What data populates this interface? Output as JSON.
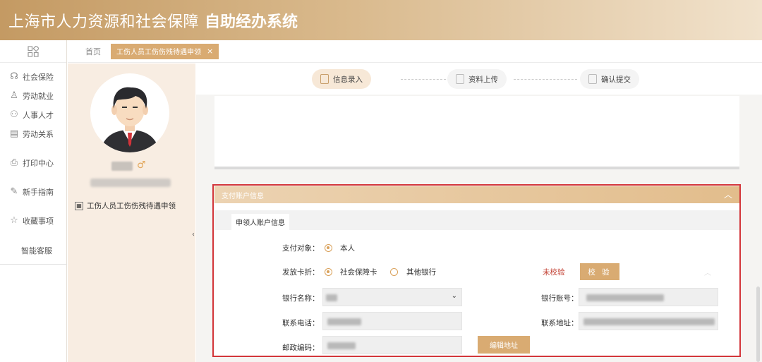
{
  "header": {
    "title": "上海市人力资源和社会保障",
    "subtitle": "自助经办系统"
  },
  "nav": {
    "apps_icon": "grid-icon",
    "items": [
      {
        "label": "社会保险",
        "icon": "headset-icon"
      },
      {
        "label": "劳动就业",
        "icon": "person-icon"
      },
      {
        "label": "人事人才",
        "icon": "people-icon"
      },
      {
        "label": "劳动关系",
        "icon": "document-icon"
      },
      {
        "label": "打印中心",
        "icon": "printer-icon"
      },
      {
        "label": "新手指南",
        "icon": "edit-icon"
      },
      {
        "label": "收藏事项",
        "icon": "star-icon"
      },
      {
        "label": "智能客服"
      }
    ]
  },
  "tabs": {
    "home": "首页",
    "active": "工伤人员工伤伤残待遇申领",
    "close": "×"
  },
  "profile": {
    "gender_symbol": "♂",
    "service_link": "工伤人员工伤伤残待遇申领"
  },
  "steps": [
    {
      "label": "信息录入",
      "state": "active"
    },
    {
      "label": "资料上传",
      "state": "pending"
    },
    {
      "label": "确认提交",
      "state": "pending"
    }
  ],
  "payment": {
    "section_title": "支付账户信息",
    "collapse_icon": "chevron-up-icon",
    "subtab": "申领人账户信息",
    "payee_label": "支付对象：",
    "payee_value": "本人",
    "card_label": "发放卡折：",
    "card_options": [
      "社会保障卡",
      "其他银行"
    ],
    "card_selected": 0,
    "verify_status": "未校验",
    "verify_button": "校 验",
    "bank_name_label": "银行名称：",
    "bank_account_label": "银行账号：",
    "phone_label": "联系电话：",
    "address_label": "联系地址：",
    "postcode_label": "邮政编码：",
    "edit_address_button": "编辑地址"
  },
  "colors": {
    "accent": "#d9ab72",
    "highlight_box": "#d3363a",
    "status_red": "#c0392b"
  }
}
